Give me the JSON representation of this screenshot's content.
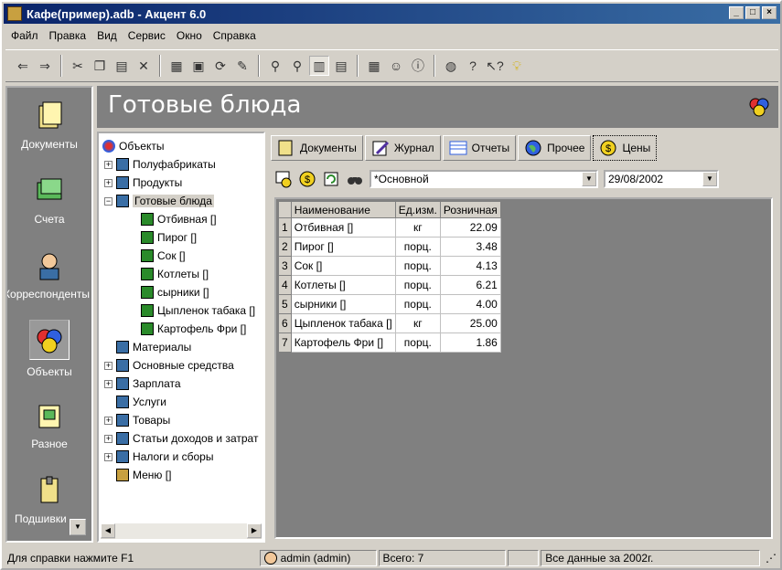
{
  "window": {
    "title": "Кафе(пример).adb - Акцент 6.0"
  },
  "menu": [
    {
      "label": "Файл"
    },
    {
      "label": "Правка"
    },
    {
      "label": "Вид"
    },
    {
      "label": "Сервис"
    },
    {
      "label": "Окно"
    },
    {
      "label": "Справка"
    }
  ],
  "sidebar": {
    "items": [
      {
        "label": "Документы"
      },
      {
        "label": "Счета"
      },
      {
        "label": "Корреспонденты"
      },
      {
        "label": "Объекты"
      },
      {
        "label": "Разное"
      },
      {
        "label": "Подшивки"
      }
    ]
  },
  "header": {
    "title": "Готовые блюда"
  },
  "tree": {
    "root": "Объекты",
    "nodes": [
      {
        "label": "Полуфабрикаты"
      },
      {
        "label": "Продукты"
      },
      {
        "label": "Готовые блюда"
      },
      {
        "label": "Отбивная []"
      },
      {
        "label": "Пирог []"
      },
      {
        "label": "Сок []"
      },
      {
        "label": "Котлеты []"
      },
      {
        "label": "сырники []"
      },
      {
        "label": "Цыпленок табака []"
      },
      {
        "label": "Картофель Фри []"
      },
      {
        "label": "Материалы"
      },
      {
        "label": "Основные средства"
      },
      {
        "label": "Зарплата"
      },
      {
        "label": "Услуги"
      },
      {
        "label": "Товары"
      },
      {
        "label": "Статьи доходов и затрат"
      },
      {
        "label": "Налоги и сборы"
      },
      {
        "label": "Меню []"
      }
    ]
  },
  "tabs": [
    {
      "label": "Документы"
    },
    {
      "label": "Журнал"
    },
    {
      "label": "Отчеты"
    },
    {
      "label": "Прочее"
    },
    {
      "label": "Цены"
    }
  ],
  "filter": {
    "price_list": "*Основной",
    "date": "29/08/2002"
  },
  "grid": {
    "columns": [
      "Наименование",
      "Ед.изм.",
      "Розничная"
    ],
    "rows": [
      {
        "n": "1",
        "name": "Отбивная []",
        "unit": "кг",
        "price": "22.09"
      },
      {
        "n": "2",
        "name": "Пирог []",
        "unit": "порц.",
        "price": "3.48"
      },
      {
        "n": "3",
        "name": "Сок []",
        "unit": "порц.",
        "price": "4.13"
      },
      {
        "n": "4",
        "name": "Котлеты []",
        "unit": "порц.",
        "price": "6.21"
      },
      {
        "n": "5",
        "name": "сырники []",
        "unit": "порц.",
        "price": "4.00"
      },
      {
        "n": "6",
        "name": "Цыпленок табака []",
        "unit": "кг",
        "price": "25.00"
      },
      {
        "n": "7",
        "name": "Картофель Фри []",
        "unit": "порц.",
        "price": "1.86"
      }
    ]
  },
  "status": {
    "help": "Для справки нажмите F1",
    "user": "admin (admin)",
    "total": "Всего: 7",
    "period": "Все данные за 2002г."
  }
}
